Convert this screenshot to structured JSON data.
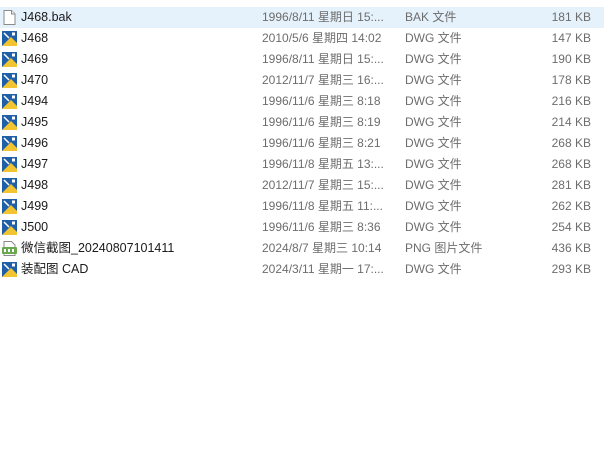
{
  "files": [
    {
      "name": "J468.bak",
      "date": "1996/8/11 星期日 15:...",
      "type": "BAK 文件",
      "size": "181 KB",
      "icon": "blank-file-icon",
      "selected": true
    },
    {
      "name": "J468",
      "date": "2010/5/6 星期四 14:02",
      "type": "DWG 文件",
      "size": "147 KB",
      "icon": "dwg-file-icon",
      "selected": false
    },
    {
      "name": "J469",
      "date": "1996/8/11 星期日 15:...",
      "type": "DWG 文件",
      "size": "190 KB",
      "icon": "dwg-file-icon",
      "selected": false
    },
    {
      "name": "J470",
      "date": "2012/11/7 星期三 16:...",
      "type": "DWG 文件",
      "size": "178 KB",
      "icon": "dwg-file-icon",
      "selected": false
    },
    {
      "name": "J494",
      "date": "1996/11/6 星期三 8:18",
      "type": "DWG 文件",
      "size": "216 KB",
      "icon": "dwg-file-icon",
      "selected": false
    },
    {
      "name": "J495",
      "date": "1996/11/6 星期三 8:19",
      "type": "DWG 文件",
      "size": "214 KB",
      "icon": "dwg-file-icon",
      "selected": false
    },
    {
      "name": "J496",
      "date": "1996/11/6 星期三 8:21",
      "type": "DWG 文件",
      "size": "268 KB",
      "icon": "dwg-file-icon",
      "selected": false
    },
    {
      "name": "J497",
      "date": "1996/11/8 星期五 13:...",
      "type": "DWG 文件",
      "size": "268 KB",
      "icon": "dwg-file-icon",
      "selected": false
    },
    {
      "name": "J498",
      "date": "2012/11/7 星期三 15:...",
      "type": "DWG 文件",
      "size": "281 KB",
      "icon": "dwg-file-icon",
      "selected": false
    },
    {
      "name": "J499",
      "date": "1996/11/8 星期五 11:...",
      "type": "DWG 文件",
      "size": "262 KB",
      "icon": "dwg-file-icon",
      "selected": false
    },
    {
      "name": "J500",
      "date": "1996/11/6 星期三 8:36",
      "type": "DWG 文件",
      "size": "254 KB",
      "icon": "dwg-file-icon",
      "selected": false
    },
    {
      "name": "微信截图_20240807101411",
      "date": "2024/8/7 星期三 10:14",
      "type": "PNG 图片文件",
      "size": "436 KB",
      "icon": "png-image-icon",
      "selected": false
    },
    {
      "name": "装配图 CAD",
      "date": "2024/3/11 星期一 17:...",
      "type": "DWG 文件",
      "size": "293 KB",
      "icon": "dwg-file-icon",
      "selected": false
    }
  ],
  "colors": {
    "selected_row": "#e5f1fb",
    "dwg_blue": "#1f5fa8",
    "dwg_yellow": "#f2c530",
    "png_green": "#6aa84f"
  }
}
